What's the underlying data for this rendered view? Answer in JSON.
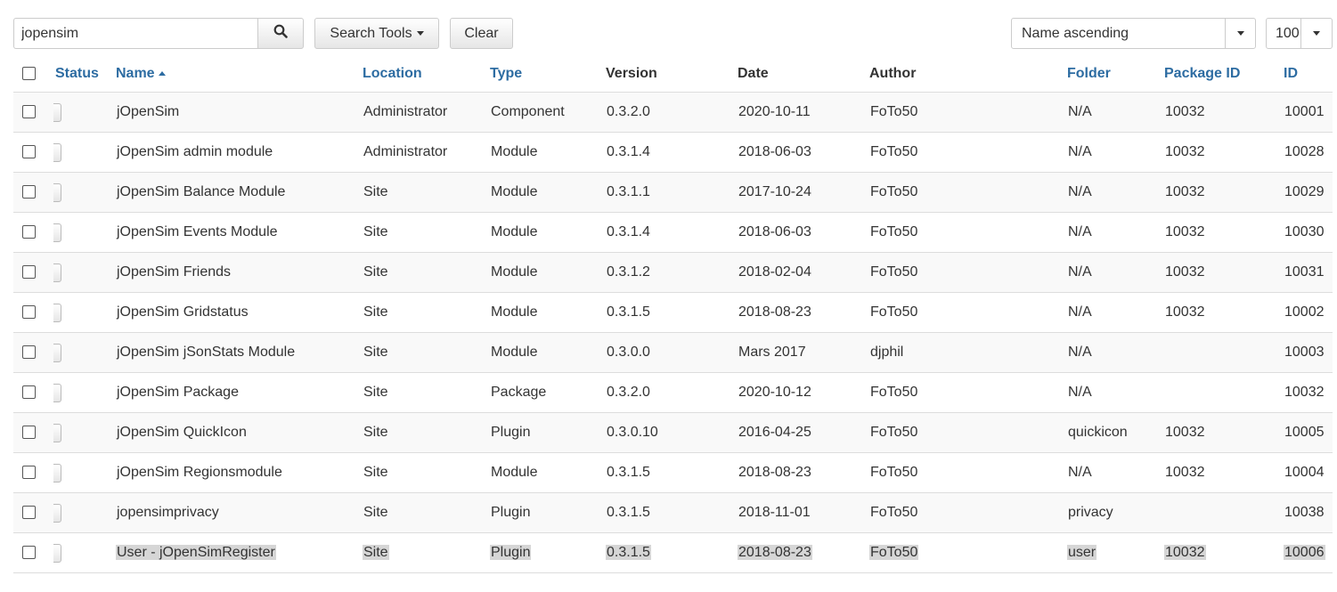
{
  "filters": {
    "search_value": "jopensim",
    "search_tools_label": "Search Tools",
    "clear_label": "Clear",
    "ordering": "Name ascending",
    "limit": "100"
  },
  "columns": {
    "status": "Status",
    "name": "Name",
    "location": "Location",
    "type": "Type",
    "version": "Version",
    "date": "Date",
    "author": "Author",
    "folder": "Folder",
    "package_id": "Package ID",
    "id": "ID"
  },
  "rows": [
    {
      "name": "jOpenSim",
      "location": "Administrator",
      "type": "Component",
      "version": "0.3.2.0",
      "date": "2020-10-11",
      "author": "FoTo50",
      "folder": "N/A",
      "package_id": "10032",
      "id": "10001"
    },
    {
      "name": "jOpenSim admin module",
      "location": "Administrator",
      "type": "Module",
      "version": "0.3.1.4",
      "date": "2018-06-03",
      "author": "FoTo50",
      "folder": "N/A",
      "package_id": "10032",
      "id": "10028"
    },
    {
      "name": "jOpenSim Balance Module",
      "location": "Site",
      "type": "Module",
      "version": "0.3.1.1",
      "date": "2017-10-24",
      "author": "FoTo50",
      "folder": "N/A",
      "package_id": "10032",
      "id": "10029"
    },
    {
      "name": "jOpenSim Events Module",
      "location": "Site",
      "type": "Module",
      "version": "0.3.1.4",
      "date": "2018-06-03",
      "author": "FoTo50",
      "folder": "N/A",
      "package_id": "10032",
      "id": "10030"
    },
    {
      "name": "jOpenSim Friends",
      "location": "Site",
      "type": "Module",
      "version": "0.3.1.2",
      "date": "2018-02-04",
      "author": "FoTo50",
      "folder": "N/A",
      "package_id": "10032",
      "id": "10031"
    },
    {
      "name": "jOpenSim Gridstatus",
      "location": "Site",
      "type": "Module",
      "version": "0.3.1.5",
      "date": "2018-08-23",
      "author": "FoTo50",
      "folder": "N/A",
      "package_id": "10032",
      "id": "10002"
    },
    {
      "name": "jOpenSim jSonStats Module",
      "location": "Site",
      "type": "Module",
      "version": "0.3.0.0",
      "date": "Mars 2017",
      "author": "djphil",
      "folder": "N/A",
      "package_id": "",
      "id": "10003"
    },
    {
      "name": "jOpenSim Package",
      "location": "Site",
      "type": "Package",
      "version": "0.3.2.0",
      "date": "2020-10-12",
      "author": "FoTo50",
      "folder": "N/A",
      "package_id": "",
      "id": "10032"
    },
    {
      "name": "jOpenSim QuickIcon",
      "location": "Site",
      "type": "Plugin",
      "version": "0.3.0.10",
      "date": "2016-04-25",
      "author": "FoTo50",
      "folder": "quickicon",
      "package_id": "10032",
      "id": "10005"
    },
    {
      "name": "jOpenSim Regionsmodule",
      "location": "Site",
      "type": "Module",
      "version": "0.3.1.5",
      "date": "2018-08-23",
      "author": "FoTo50",
      "folder": "N/A",
      "package_id": "10032",
      "id": "10004"
    },
    {
      "name": "jopensimprivacy",
      "location": "Site",
      "type": "Plugin",
      "version": "0.3.1.5",
      "date": "2018-11-01",
      "author": "FoTo50",
      "folder": "privacy",
      "package_id": "",
      "id": "10038"
    },
    {
      "name": "User - jOpenSimRegister",
      "location": "Site",
      "type": "Plugin",
      "version": "0.3.1.5",
      "date": "2018-08-23",
      "author": "FoTo50",
      "folder": "user",
      "package_id": "10032",
      "id": "10006"
    }
  ],
  "highlighted_row_index": 11,
  "colors": {
    "link": "#2d6ca2",
    "check": "#3a8a3a",
    "border": "#dddddd",
    "stripe": "#f9f9f9",
    "highlight": "#d6d6d6"
  },
  "icons": {
    "search": "search-icon",
    "status": "check-icon",
    "sort": "sort-asc-icon"
  }
}
